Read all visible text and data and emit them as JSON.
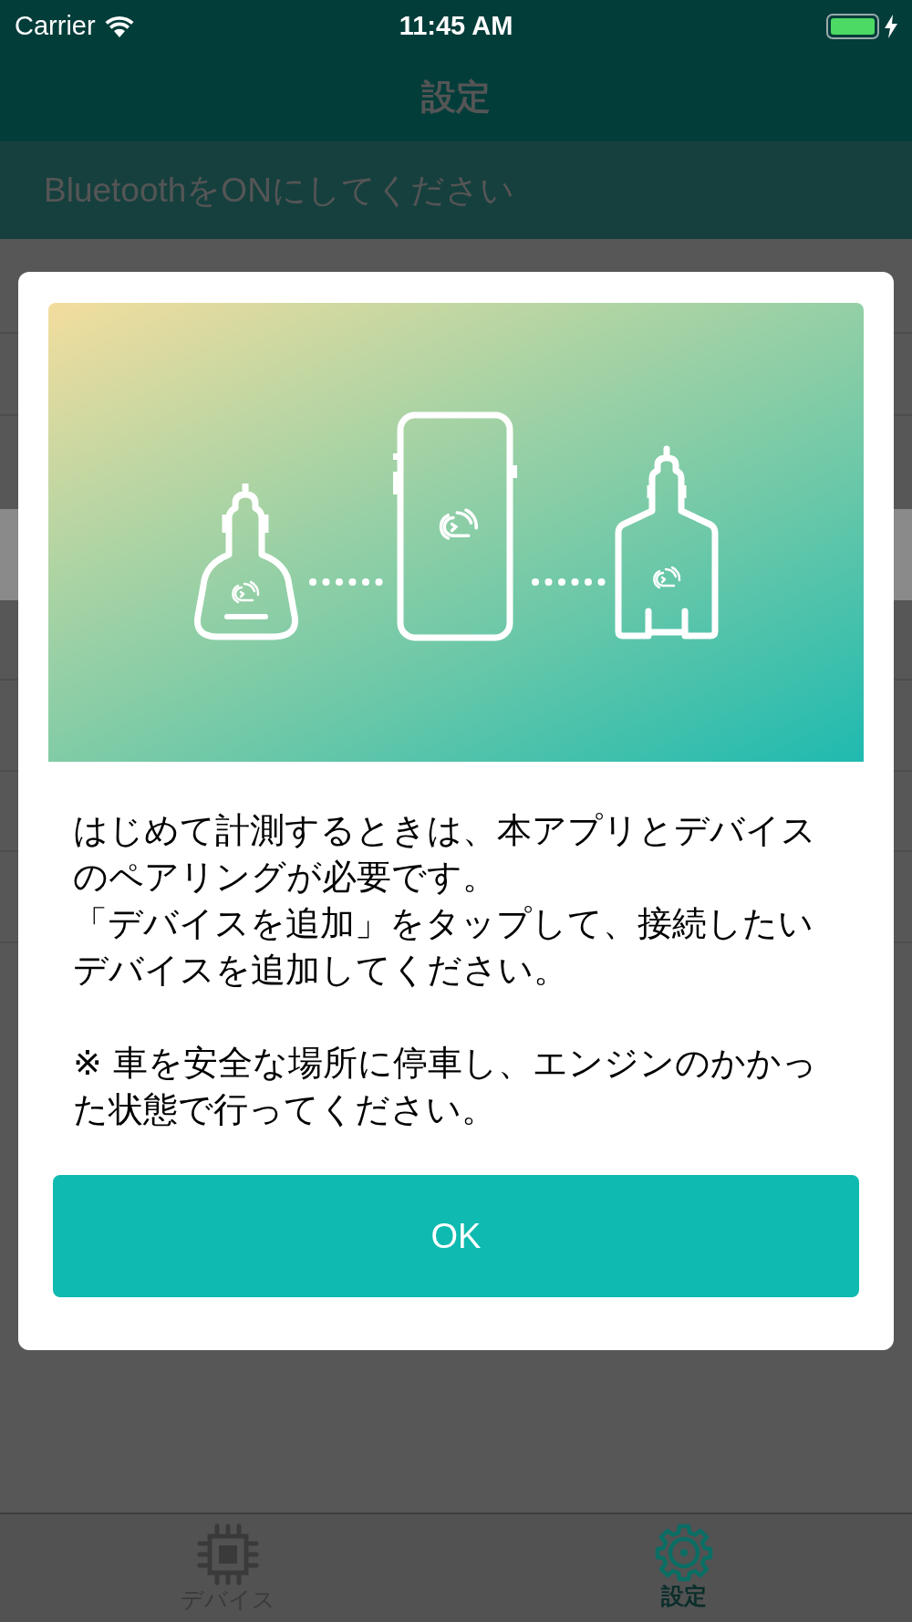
{
  "status_bar": {
    "carrier": "Carrier",
    "time": "11:45 AM"
  },
  "nav_bar": {
    "title": "設定"
  },
  "banner": {
    "text": "BluetoothをONにしてください"
  },
  "dialog": {
    "paragraphs": [
      "はじめて計測するときは、本アプリとデバイスのペアリングが必要です。",
      "「デバイスを追加」をタップして、接続したいデバイスを追加してください。",
      "※ 車を安全な場所に停車し、エンジンのかかった状態で行ってください。"
    ],
    "button": "OK"
  },
  "tab_bar": [
    {
      "label": "デバイス",
      "kind": "chip",
      "selected": false
    },
    {
      "label": "設定",
      "kind": "gear",
      "selected": true
    }
  ]
}
